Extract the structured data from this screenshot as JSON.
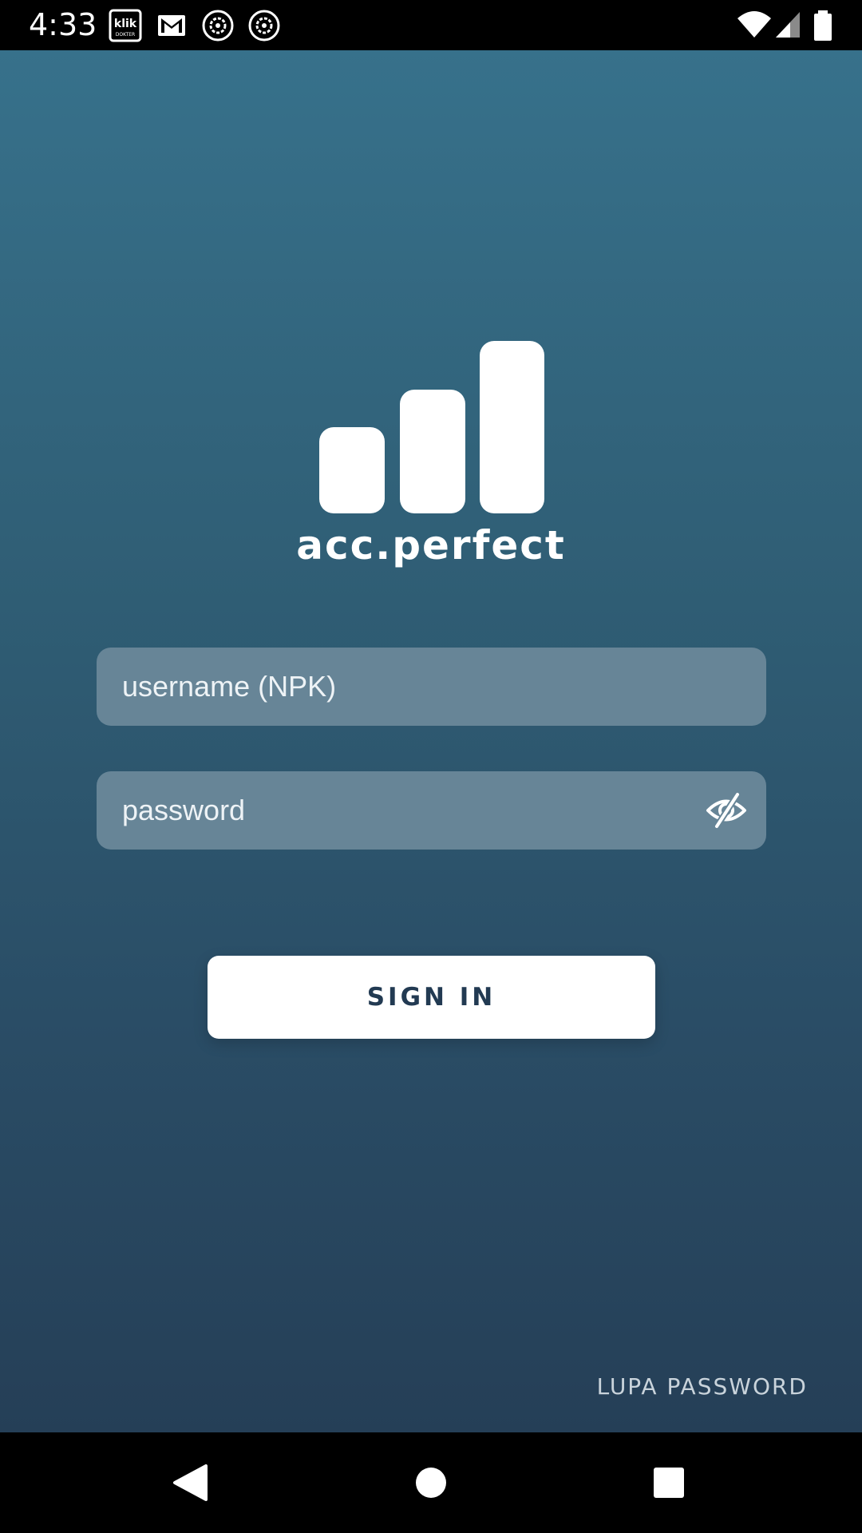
{
  "status_bar": {
    "time": "4:33",
    "notification_icons": [
      "klik-dokter-icon",
      "gmail-icon",
      "settings-gear-icon",
      "settings-gear-icon"
    ],
    "system_icons": [
      "wifi-icon",
      "cell-signal-icon",
      "battery-icon"
    ],
    "klik_icon_text": "klik",
    "klik_icon_subtext": "DOKTER"
  },
  "brand": {
    "name": "acc.perfect",
    "logo_icon": "bar-chart-logo",
    "logo_color": "#ffffff"
  },
  "form": {
    "username": {
      "value": "",
      "placeholder": "username (NPK)"
    },
    "password": {
      "value": "",
      "placeholder": "password",
      "toggle_icon": "eye-off-icon"
    },
    "sign_in_label": "SIGN IN"
  },
  "forgot_password_label": "LUPA PASSWORD",
  "nav_bar": {
    "buttons": [
      "back-icon",
      "home-icon",
      "recents-icon"
    ]
  },
  "colors": {
    "background_top": "#37718b",
    "background_bottom": "#253f57",
    "field_background": "#678597",
    "button_background": "#ffffff",
    "button_text": "#223a52"
  }
}
